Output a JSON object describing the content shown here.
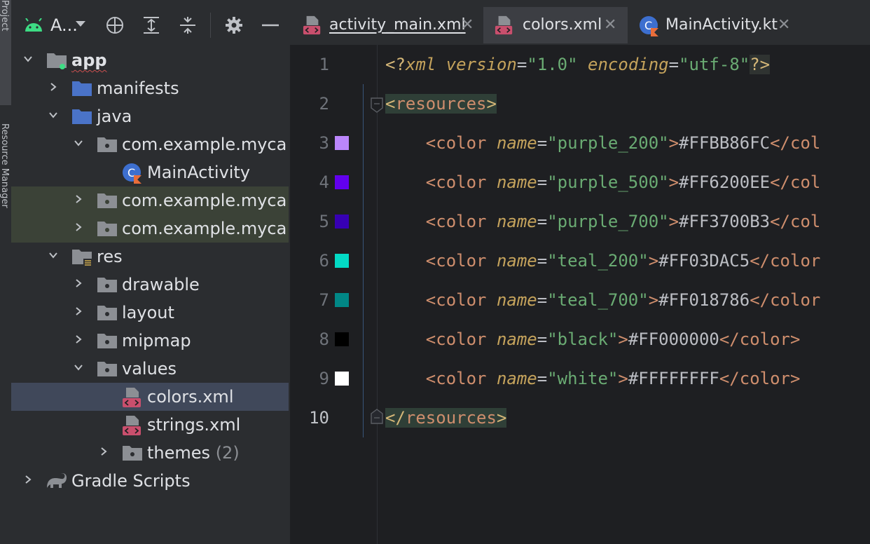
{
  "side_strip": {
    "project_tab": "Project",
    "resource_manager_tab": "Resource Manager"
  },
  "project_panel": {
    "title": "A...",
    "icons": [
      "android-icon",
      "target-icon",
      "expand-all-icon",
      "collapse-all-icon",
      "gear-icon",
      "minimize-icon"
    ],
    "tree": [
      {
        "label": "app",
        "icon": "module-folder-icon",
        "expanded": true
      },
      {
        "label": "manifests",
        "icon": "folder-icon",
        "expanded": false
      },
      {
        "label": "java",
        "icon": "folder-icon",
        "expanded": true
      },
      {
        "label": "com.example.myca",
        "icon": "package-icon",
        "expanded": true
      },
      {
        "label": "MainActivity",
        "icon": "kotlin-class-icon"
      },
      {
        "label": "com.example.myca",
        "icon": "package-icon",
        "expanded": false
      },
      {
        "label": "com.example.myca",
        "icon": "package-icon",
        "expanded": false
      },
      {
        "label": "res",
        "icon": "resources-folder-icon",
        "expanded": true
      },
      {
        "label": "drawable",
        "icon": "package-icon",
        "expanded": false
      },
      {
        "label": "layout",
        "icon": "package-icon",
        "expanded": false
      },
      {
        "label": "mipmap",
        "icon": "package-icon",
        "expanded": false
      },
      {
        "label": "values",
        "icon": "package-icon",
        "expanded": true
      },
      {
        "label": "colors.xml",
        "icon": "xml-file-icon",
        "selected": true
      },
      {
        "label": "strings.xml",
        "icon": "xml-file-icon"
      },
      {
        "label": "themes",
        "count": "(2)",
        "icon": "package-icon",
        "expanded": false
      },
      {
        "label": "Gradle Scripts",
        "icon": "gradle-icon",
        "expanded": false
      }
    ]
  },
  "tabs": [
    {
      "label": "activity_main.xml",
      "close": "✕"
    },
    {
      "label": "colors.xml",
      "close": "✕",
      "active": true
    },
    {
      "label": "MainActivity.kt",
      "close": "✕"
    }
  ],
  "editor": {
    "line_numbers": [
      "1",
      "2",
      "3",
      "4",
      "5",
      "6",
      "7",
      "8",
      "9",
      "10"
    ],
    "xml_decl": {
      "open": "<?",
      "kw": "xml",
      "v_attr": "version",
      "v_val": "\"1.0\"",
      "e_attr": "encoding",
      "e_val": "\"utf-8\"",
      "close": "?>"
    },
    "resources_tag": "resources",
    "colors": [
      {
        "name": "\"purple_200\"",
        "value": "#FFBB86FC",
        "close": "</col",
        "swatch": "#BB86FC"
      },
      {
        "name": "\"purple_500\"",
        "value": "#FF6200EE",
        "close": "</col",
        "swatch": "#6200EE"
      },
      {
        "name": "\"purple_700\"",
        "value": "#FF3700B3",
        "close": "</col",
        "swatch": "#3700B3"
      },
      {
        "name": "\"teal_200\"",
        "value": "#FF03DAC5",
        "close": "</color",
        "swatch": "#03DAC5"
      },
      {
        "name": "\"teal_700\"",
        "value": "#FF018786",
        "close": "</color",
        "swatch": "#018786"
      },
      {
        "name": "\"black\"",
        "value": "#FF000000",
        "close": "</color>",
        "swatch": "#000000"
      },
      {
        "name": "\"white\"",
        "value": "#FFFFFFFF",
        "close": "</color>",
        "swatch": "#FFFFFF"
      }
    ],
    "color_tag": "color",
    "name_attr": "name"
  }
}
